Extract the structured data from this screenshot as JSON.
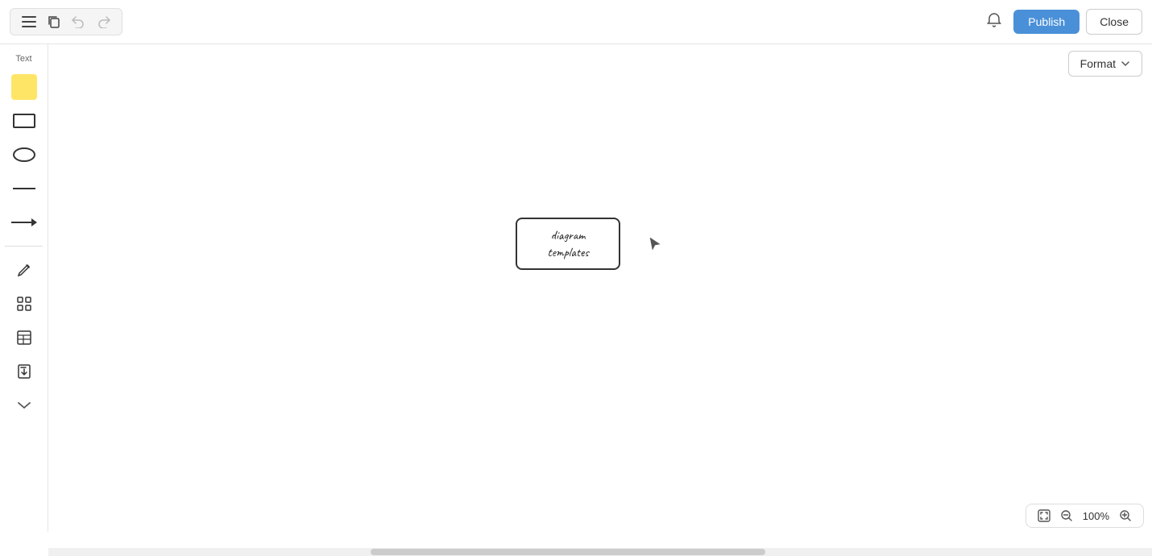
{
  "toolbar": {
    "menu_icon": "☰",
    "copy_icon": "⧉",
    "undo_icon": "↺",
    "redo_icon": "↻",
    "notification_icon": "🔔",
    "publish_label": "Publish",
    "close_label": "Close"
  },
  "format_bar": {
    "label": "Format",
    "chevron": "▾"
  },
  "sidebar": {
    "text_label": "Text",
    "items": [
      {
        "name": "text-tool",
        "label": "Text"
      },
      {
        "name": "sticky-note",
        "label": "Sticky Note"
      },
      {
        "name": "rectangle-tool",
        "label": "Rectangle"
      },
      {
        "name": "ellipse-tool",
        "label": "Ellipse"
      },
      {
        "name": "line-tool",
        "label": "Line"
      },
      {
        "name": "arrow-tool",
        "label": "Arrow"
      },
      {
        "name": "pen-tool",
        "label": "Pen"
      },
      {
        "name": "grid-tool",
        "label": "Grid"
      },
      {
        "name": "table-tool",
        "label": "Table"
      },
      {
        "name": "import-tool",
        "label": "Import"
      },
      {
        "name": "expand-tool",
        "label": "Expand"
      }
    ]
  },
  "canvas": {
    "node_text": "diagram\ntemplates"
  },
  "zoom": {
    "fit_icon": "⊡",
    "zoom_out_icon": "−",
    "level": "100%",
    "zoom_in_icon": "+"
  }
}
